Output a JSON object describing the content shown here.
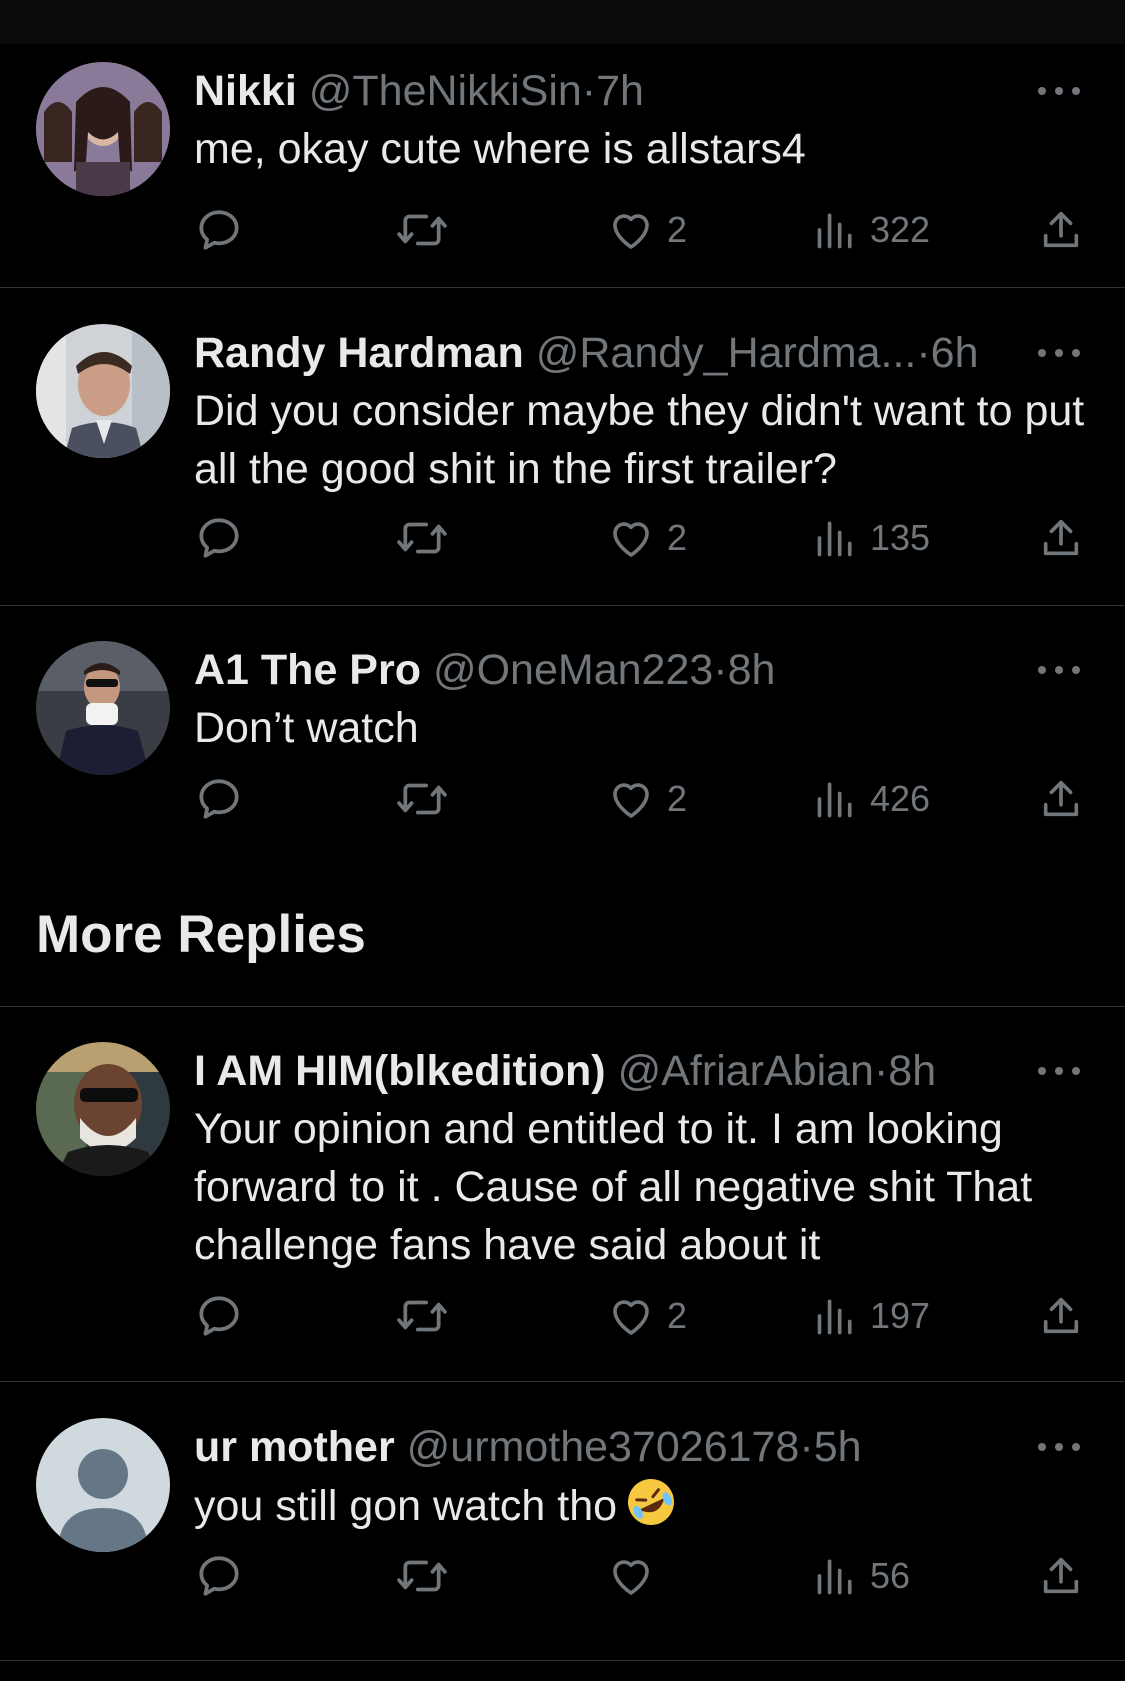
{
  "replies": [
    {
      "name": "Nikki",
      "handle": "@TheNikkiSin",
      "time": "7h",
      "text": "me, okay cute where is allstars4",
      "likes": "2",
      "views": "322"
    },
    {
      "name": "Randy Hardman",
      "handle": "@Randy_Hardma...",
      "time": "6h",
      "text": "Did you consider maybe they didn't want to put all the good shit in the first trailer?",
      "likes": "2",
      "views": "135"
    },
    {
      "name": "A1 The Pro",
      "handle": "@OneMan223",
      "time": "8h",
      "text": "Don’t watch",
      "likes": "2",
      "views": "426"
    },
    {
      "name": "I AM HIM(blkedition)",
      "handle": "@AfriarAbian",
      "time": "8h",
      "text": "Your opinion and entitled  to it. I am looking forward to it . Cause of all negative shit That challenge fans have said about it",
      "likes": "2",
      "views": "197"
    },
    {
      "name": "ur mother",
      "handle": "@urmothe37026178",
      "time": "5h",
      "text": "you still gon watch tho",
      "likes": "",
      "views": "56"
    }
  ],
  "section": {
    "more_replies": "More Replies"
  },
  "separator": "·",
  "icons": {
    "reply": "reply-icon",
    "retweet": "retweet-icon",
    "like": "heart-icon",
    "views": "views-icon",
    "share": "share-icon",
    "more": "more-icon",
    "emoji": "rolling-on-floor-laughing-emoji"
  },
  "colors": {
    "background": "#000000",
    "text": "#e7e9ea",
    "muted": "#71767b",
    "divider": "#2f3336"
  }
}
